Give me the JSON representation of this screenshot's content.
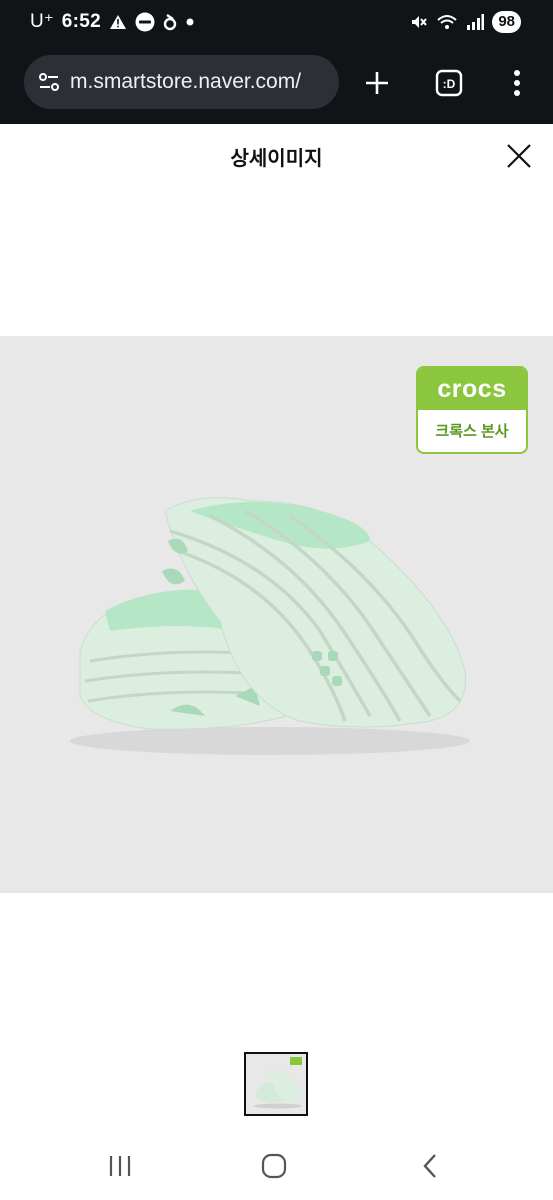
{
  "status_bar": {
    "carrier": "U⁺",
    "time": "6:52",
    "battery": "98",
    "icons": [
      "alert-icon",
      "notification-badge-icon",
      "app-icon",
      "dot-icon",
      "mute-icon",
      "wifi-icon",
      "signal-icon"
    ]
  },
  "browser": {
    "url": "m.smartstore.naver.com/",
    "icons": [
      "site-settings-icon",
      "new-tab-icon",
      "tab-switcher-icon",
      "more-icon"
    ]
  },
  "page": {
    "title": "상세이미지",
    "close_icon": "close-icon"
  },
  "product_image": {
    "badge_brand": "crocs",
    "badge_text": "크록스 본사",
    "description_icon": "clog-shoe-image"
  },
  "colors": {
    "brand_green": "#8cc63f",
    "shoe_color": "#d9ecdf",
    "image_bg": "#e8e8e9",
    "bar_dark": "#111417"
  },
  "nav": {
    "icons": [
      "recent-apps-icon",
      "home-icon",
      "back-icon"
    ]
  }
}
